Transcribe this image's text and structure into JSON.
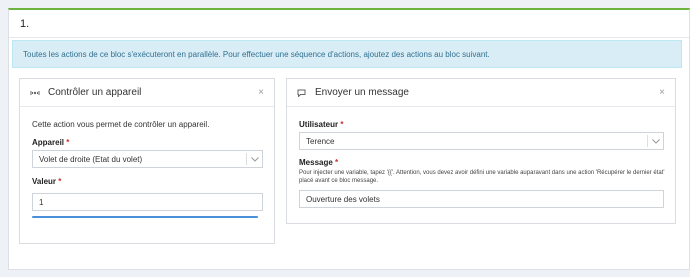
{
  "block": {
    "title": "1."
  },
  "banner": {
    "text": "Toutes les actions de ce bloc s'exécuteront en parallèle. Pour effectuer une séquence d'actions, ajoutez des actions au bloc suivant."
  },
  "control_card": {
    "title": "Contrôler un appareil",
    "close": "×",
    "description": "Cette action vous permet de contrôler un appareil.",
    "device_label": "Appareil",
    "device_value": "Volet de droite (Etat du volet)",
    "value_label": "Valeur",
    "value": "1",
    "slider_level": 1.0,
    "required": "*"
  },
  "message_card": {
    "title": "Envoyer un message",
    "close": "×",
    "user_label": "Utilisateur",
    "user_value": "Terence",
    "message_label": "Message",
    "hint": "Pour injecter une variable, tapez '{{'. Attention, vous devez avoir défini une variable auparavant dans une action 'Récupérer le dernier état' placé avant ce bloc message.",
    "message_value": "Ouverture des volets",
    "required": "*"
  },
  "icons": {
    "control": "device-remote-icon",
    "message": "message-bubble-icon",
    "chevron": "chevron-down-icon",
    "close": "close-icon"
  },
  "colors": {
    "accent_top": "#6cb33f",
    "banner_bg": "#d9edf7",
    "banner_text": "#31708f",
    "slider": "#4a90d9",
    "required": "#c9302c"
  }
}
